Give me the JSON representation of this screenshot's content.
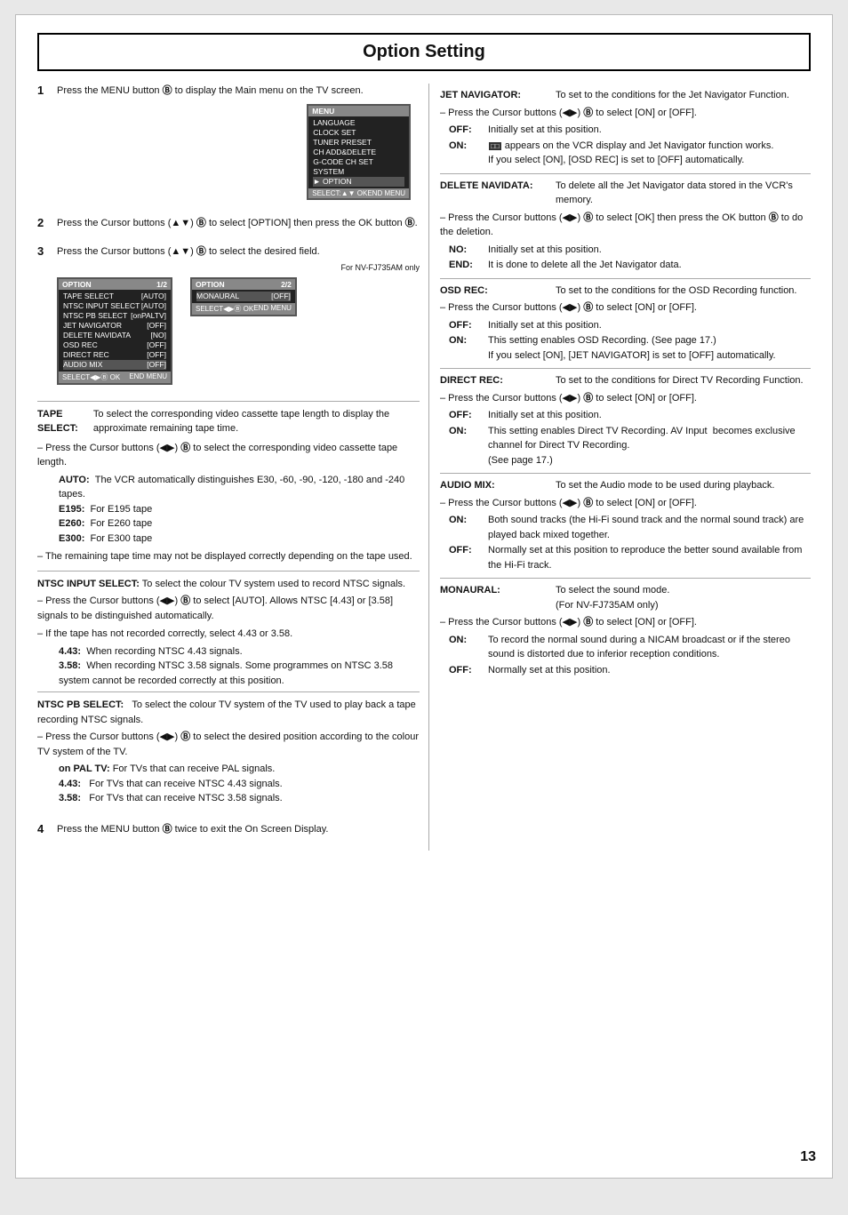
{
  "title": "Option Setting",
  "page_number": "13",
  "steps": [
    {
      "num": "1",
      "text": "Press the MENU button ⓩ to display the Main menu on the TV screen."
    },
    {
      "num": "2",
      "text": "Press the Cursor buttons (▲▼) ⓩ to select [OPTION] then press the OK button ⓩ."
    },
    {
      "num": "3",
      "text": "Press the Cursor buttons (▲▼) ⓩ to select the desired field."
    },
    {
      "num": "4",
      "text": "Press the MENU button ⓩ twice to exit the On Screen Display."
    }
  ],
  "menu1": {
    "title_left": "OPTION",
    "title_right": "1/2",
    "rows": [
      {
        "label": "TAPE SELECT",
        "value": "[AUTO]",
        "highlight": false
      },
      {
        "label": "NTSC INPUT SELECT",
        "value": "[AUTO]",
        "highlight": false
      },
      {
        "label": "NTSC PB SELECT",
        "value": "[onPALTV]",
        "highlight": false
      },
      {
        "label": "JET NAVIGATOR",
        "value": "[OFF]",
        "highlight": false
      },
      {
        "label": "DELETE NAVIDATA",
        "value": "[NO]",
        "highlight": false
      },
      {
        "label": "OSD REC",
        "value": "[OFF]",
        "highlight": false
      },
      {
        "label": "DIRECT REC",
        "value": "[OFF]",
        "highlight": false
      },
      {
        "label": "AUDIO MIX",
        "value": "[OFF]",
        "highlight": true
      }
    ],
    "bottom_left": "SELECT◄►ⓩ OK",
    "bottom_right": "END MENU"
  },
  "menu2": {
    "title_left": "OPTION",
    "title_right": "2/2",
    "rows": [
      {
        "label": "MONAURAL",
        "value": "[OFF]",
        "highlight": true
      }
    ],
    "bottom_left": "SELECT◄►ⓩ OK",
    "bottom_right": "END MENU",
    "note": "For NV-FJ735AM only"
  },
  "main_menu": {
    "rows": [
      "LANGUAGE",
      "CLOCK SET",
      "TUNER PRESET",
      "CH ADD&DELETE",
      "G-CODE CH SET",
      "SYSTEM",
      "► OPTION"
    ]
  },
  "left_sections": [
    {
      "id": "tape-select",
      "title": "TAPE SELECT:",
      "desc": "To select the corresponding video cassette tape length to display the approximate remaining tape time.",
      "dash": "– Press the Cursor buttons (◄►) ⓩ to select the corresponding video cassette tape length.",
      "items": [
        {
          "key": "AUTO:",
          "text": "The VCR automatically distinguishes E30, -60, -90, -120, -180 and -240 tapes."
        },
        {
          "key": "E195:",
          "text": "For E195 tape"
        },
        {
          "key": "E260:",
          "text": "For E260 tape"
        },
        {
          "key": "E300:",
          "text": "For E300 tape"
        }
      ],
      "note": "– The remaining tape time may not be displayed correctly depending on the tape used."
    },
    {
      "id": "ntsc-input-select",
      "title": "NTSC INPUT SELECT:",
      "desc": "To select the colour TV system used to record NTSC signals.",
      "dash": "– Press the Cursor buttons (◄►) ⓩ to select [AUTO]. Allows NTSC [4.43] or [3.58] signals to be distinguished automatically.",
      "items": [],
      "note": "– If the tape has not recorded correctly, select 4.43 or 3.58.",
      "sub_items": [
        {
          "key": "4.43:",
          "text": "When recording NTSC 4.43 signals."
        },
        {
          "key": "3.58:",
          "text": "When recording NTSC 3.58 signals. Some programmes on NTSC 3.58 system cannot be recorded correctly at this position."
        }
      ]
    },
    {
      "id": "ntsc-pb-select",
      "title": "NTSC PB SELECT:",
      "desc": "To select the colour TV system of the TV used to play back a tape recording NTSC signals.",
      "dash": "– Press the Cursor buttons (◄►) ⓩ to select the desired position according to the colour TV system of the TV.",
      "items": [],
      "sub_items": [
        {
          "key": "on PAL TV:",
          "text": "For TVs that can receive PAL signals."
        },
        {
          "key": "4.43:",
          "text": "For TVs that can receive NTSC 4.43 signals."
        },
        {
          "key": "3.58:",
          "text": "For TVs that can receive NTSC 3.58 signals."
        }
      ]
    }
  ],
  "right_sections": [
    {
      "id": "jet-navigator",
      "key": "JET NAVIGATOR:",
      "desc": "To set to the conditions for the Jet Navigator Function.",
      "dash": "– Press the Cursor buttons (◄►) ⓩ to select [ON] or [OFF].",
      "off_on": [
        {
          "key": "OFF:",
          "text": "Initially set at this position."
        },
        {
          "key": "ON:",
          "text": "ⓢⓢ appears on the VCR display and Jet Navigator function works.\nIf you select [ON], [OSD REC] is set to [OFF] automatically."
        }
      ]
    },
    {
      "id": "delete-navidata",
      "key": "DELETE NAVIDATA:",
      "desc": "To delete all the Jet Navigator data stored in the VCR's memory.",
      "dash": "– Press the Cursor buttons (◄►) ⓩ to select [OK] then press the OK button ⓩ to do the deletion.",
      "off_on": [
        {
          "key": "NO:",
          "text": "Initially set at this position."
        },
        {
          "key": "END:",
          "text": "It is done to delete all the Jet Navigator data."
        }
      ]
    },
    {
      "id": "osd-rec",
      "key": "OSD REC:",
      "desc": "To set to the conditions for the OSD Recording function.",
      "dash": "– Press the Cursor buttons (◄►) ⓩ to select [ON] or [OFF].",
      "off_on": [
        {
          "key": "OFF:",
          "text": "Initially set at this position."
        },
        {
          "key": "ON:",
          "text": "This setting enables OSD Recording. (See page 17.)\nIf you select [ON], [JET NAVIGATOR] is set to [OFF] automatically."
        }
      ]
    },
    {
      "id": "direct-rec",
      "key": "DIRECT REC:",
      "desc": "To set to the conditions for Direct TV Recording Function.",
      "dash": "– Press the Cursor buttons (◄►) ⓩ to select [ON] or [OFF].",
      "off_on": [
        {
          "key": "OFF:",
          "text": "Initially set at this position."
        },
        {
          "key": "ON:",
          "text": "This setting enables Direct TV Recording. AV Input  becomes exclusive channel for Direct TV Recording.\n(See page 17.)"
        }
      ]
    },
    {
      "id": "audio-mix",
      "key": "AUDIO MIX:",
      "desc": "To set the Audio mode to be used during playback.",
      "dash": "– Press the Cursor buttons (◄►) ⓩ to select [ON] or [OFF].",
      "off_on": [
        {
          "key": "ON:",
          "text": "Both sound tracks (the Hi-Fi sound track and the normal sound track) are played back mixed together."
        },
        {
          "key": "OFF:",
          "text": "Normally set at this position to reproduce the better sound available from the Hi-Fi track."
        }
      ]
    },
    {
      "id": "monaural",
      "key": "MONAURAL:",
      "desc": "To select the sound mode.\n(For NV-FJ735AM only)",
      "dash": "– Press the Cursor buttons (◄►) ⓩ to select [ON] or [OFF].",
      "off_on": [
        {
          "key": "ON:",
          "text": "To record the normal sound during a NICAM broadcast or if the stereo sound is distorted due to inferior reception conditions."
        },
        {
          "key": "OFF:",
          "text": "Normally set at this position."
        }
      ]
    }
  ]
}
